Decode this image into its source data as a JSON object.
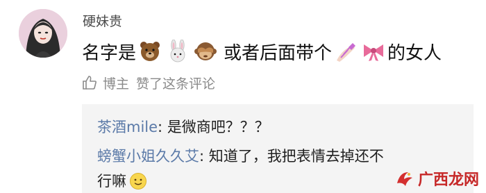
{
  "comment": {
    "username": "硬妹贵",
    "text_before": "名字是",
    "emojis_first": [
      "bear-emoji",
      "rabbit-emoji",
      "see-no-evil-monkey-emoji"
    ],
    "text_middle": "或者后面带个",
    "emojis_second": [
      "nail-polish-emoji",
      "ribbon-emoji"
    ],
    "text_after": "的女人"
  },
  "meta": {
    "like_icon": "thumbs-up-icon",
    "author_tag": "博主",
    "liked_text": "赞了这条评论"
  },
  "replies": [
    {
      "name": "茶酒mile",
      "separator": ": ",
      "text": "是微商吧？？？"
    },
    {
      "name": "螃蟹小姐久久艾",
      "separator": ": ",
      "text": "知道了，我把表情去掉还不",
      "text_cont": "行嘛",
      "emoji": "slightly-smiling-face-emoji"
    }
  ],
  "watermark": {
    "text": "广西龙网",
    "icon": "watermark-logo-icon"
  }
}
